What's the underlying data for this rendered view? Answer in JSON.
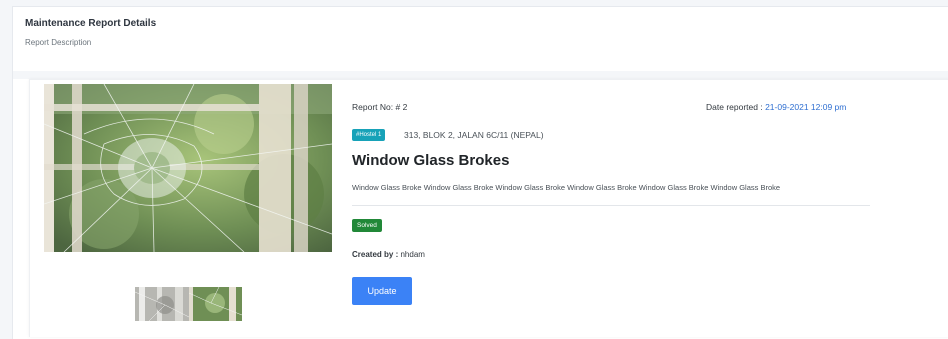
{
  "header": {
    "title": "Maintenance Report Details",
    "subtitle": "Report Description"
  },
  "report": {
    "number_label": "Report No:",
    "number_value": "# 2",
    "date_label": "Date reported :",
    "date_value": "21-09-2021 12:09 pm",
    "hostel_tag": "#Hostel 1",
    "address": "313, BLOK 2, JALAN 6C/11 (NEPAL)",
    "title": "Window Glass Brokes",
    "description": "Window Glass Broke Window Glass Broke Window Glass Broke Window Glass Broke Window Glass Broke Window Glass Broke",
    "status": "Solved",
    "created_by_label": "Created by :",
    "created_by_value": "nhdam",
    "update_label": "Update"
  },
  "colors": {
    "tag": "#17a2b8",
    "status": "#218838",
    "button": "#3b82f6",
    "date": "#2f6fd1"
  },
  "icons": [
    "broken-window-photo",
    "thumbnail-photo"
  ]
}
